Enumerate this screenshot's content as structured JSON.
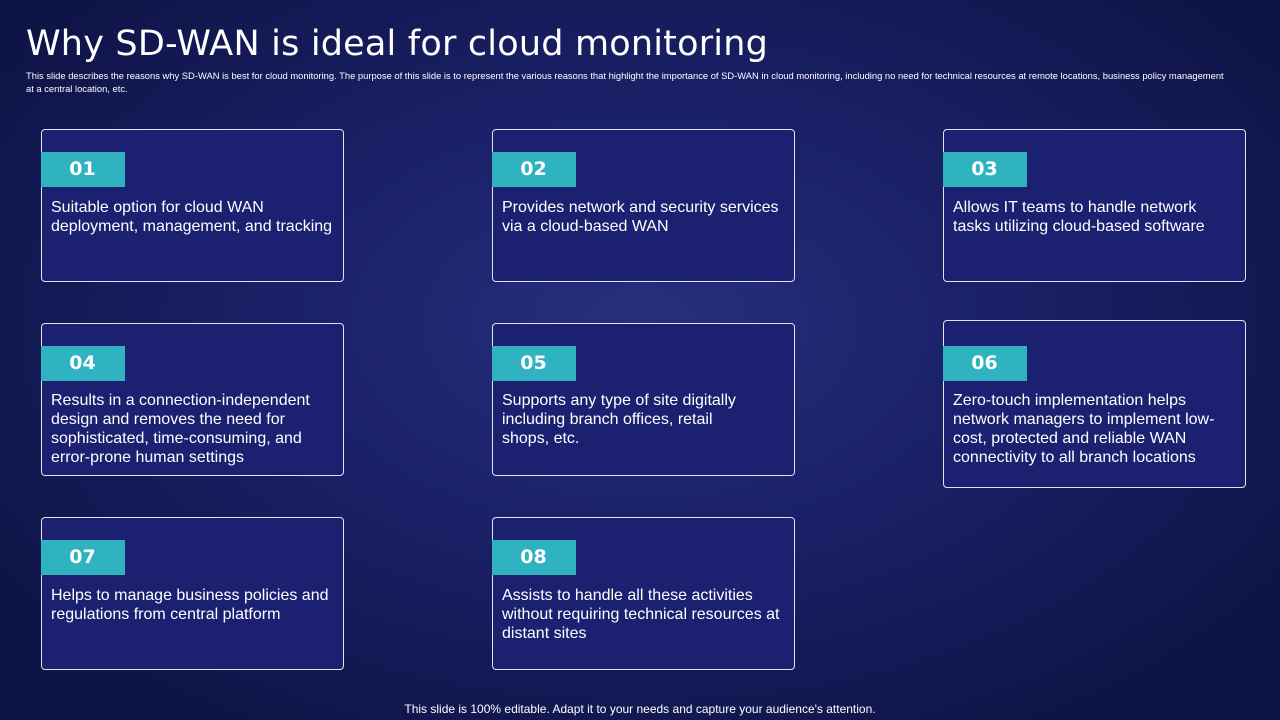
{
  "slide": {
    "title": "Why SD-WAN is ideal for cloud monitoring",
    "subtitle": "This slide describes the reasons why SD-WAN is best for cloud monitoring. The purpose of this slide is to represent the various reasons that highlight the importance of SD-WAN in cloud monitoring, including no need for technical resources at remote locations, business policy management at a central location, etc.",
    "footer": "This slide is 100% editable. Adapt it to your needs and capture your audience's attention."
  },
  "cards": [
    {
      "number": "01",
      "text": "Suitable option for cloud WAN deployment, management, and tracking"
    },
    {
      "number": "02",
      "text": "Provides network and security services via a cloud-based WAN"
    },
    {
      "number": "03",
      "text": "Allows IT teams to handle network tasks utilizing cloud-based software"
    },
    {
      "number": "04",
      "text": "Results in a connection-independent design and removes the need for sophisticated, time-consuming, and error-prone human settings"
    },
    {
      "number": "05",
      "text": "Supports any type of site digitally including branch offices, retail shops, etc."
    },
    {
      "number": "06",
      "text": "Zero-touch implementation helps network managers to implement low-cost, protected and reliable WAN connectivity to all branch locations"
    },
    {
      "number": "07",
      "text": "Helps to manage business policies and regulations from central platform"
    },
    {
      "number": "08",
      "text": "Assists to handle all these activities without requiring technical resources at distant sites"
    }
  ],
  "colors": {
    "background": "#1a2168",
    "card_fill": "#1c2070",
    "card_border": "#dfe3f2",
    "badge": "#2fb3c1",
    "text": "#ffffff"
  }
}
